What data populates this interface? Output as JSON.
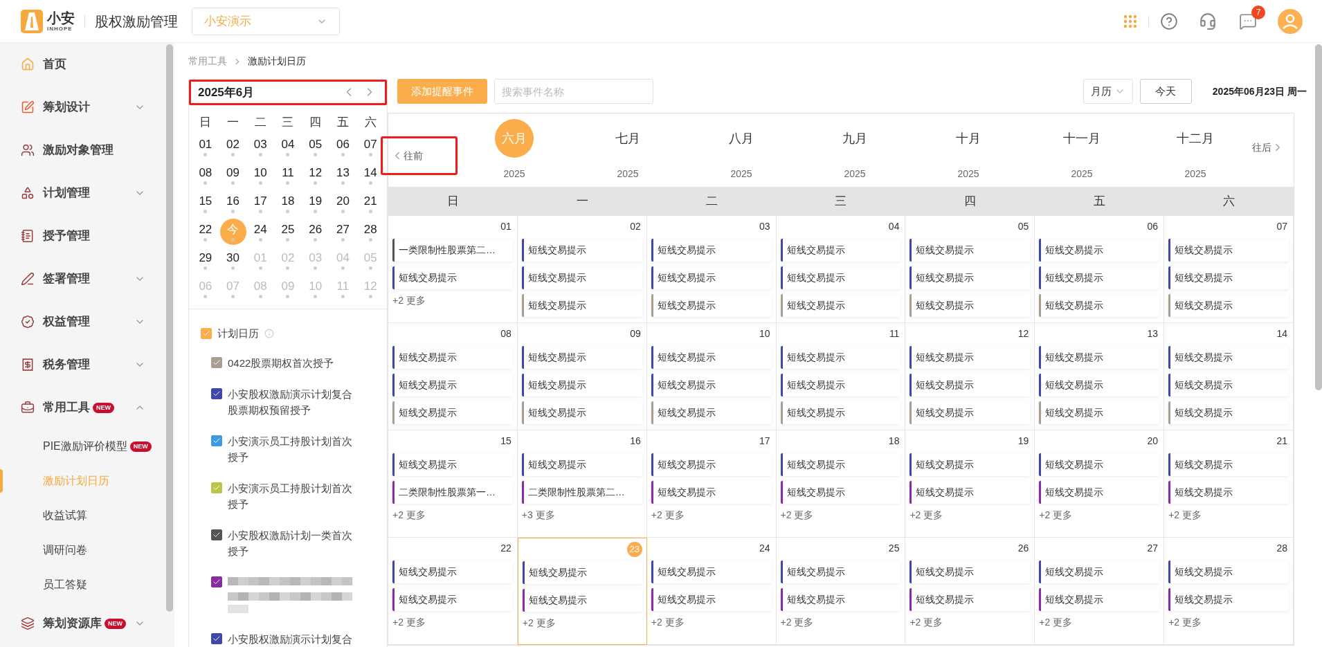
{
  "header": {
    "logo_text": "小安",
    "logo_sub": "INHOPE",
    "app_title": "股权激励管理",
    "company_select": "小安演示",
    "notification_count": "7"
  },
  "sidebar": {
    "items": [
      {
        "kind": "link",
        "label": "首页",
        "selected": false
      },
      {
        "kind": "group",
        "label": "筹划设计",
        "expanded": false
      },
      {
        "kind": "link",
        "label": "激励对象管理",
        "selected": false
      },
      {
        "kind": "group",
        "label": "计划管理",
        "expanded": false
      },
      {
        "kind": "link",
        "label": "授予管理",
        "selected": false
      },
      {
        "kind": "group",
        "label": "签署管理",
        "expanded": false
      },
      {
        "kind": "group",
        "label": "权益管理",
        "expanded": false
      },
      {
        "kind": "group",
        "label": "税务管理",
        "expanded": false
      },
      {
        "kind": "group",
        "label": "常用工具",
        "badge": "NEW",
        "expanded": true,
        "children": [
          {
            "label": "PIE激励评价模型",
            "badge": "NEW",
            "selected": false
          },
          {
            "label": "激励计划日历",
            "selected": true
          },
          {
            "label": "收益试算",
            "selected": false
          },
          {
            "label": "调研问卷",
            "selected": false
          },
          {
            "label": "员工答疑",
            "selected": false
          }
        ]
      },
      {
        "kind": "group",
        "label": "筹划资源库",
        "badge": "NEW",
        "expanded": false
      }
    ]
  },
  "breadcrumb": [
    "常用工具",
    "激励计划日历"
  ],
  "mini_calendar": {
    "title": "2025年6月",
    "weekdays": [
      "日",
      "一",
      "二",
      "三",
      "四",
      "五",
      "六"
    ],
    "weeks": [
      [
        {
          "label": "01",
          "other_month": false,
          "today": false
        },
        {
          "label": "02",
          "other_month": false,
          "today": false
        },
        {
          "label": "03",
          "other_month": false,
          "today": false
        },
        {
          "label": "04",
          "other_month": false,
          "today": false
        },
        {
          "label": "05",
          "other_month": false,
          "today": false
        },
        {
          "label": "06",
          "other_month": false,
          "today": false
        },
        {
          "label": "07",
          "other_month": false,
          "today": false
        }
      ],
      [
        {
          "label": "08",
          "other_month": false,
          "today": false
        },
        {
          "label": "09",
          "other_month": false,
          "today": false
        },
        {
          "label": "10",
          "other_month": false,
          "today": false
        },
        {
          "label": "11",
          "other_month": false,
          "today": false
        },
        {
          "label": "12",
          "other_month": false,
          "today": false
        },
        {
          "label": "13",
          "other_month": false,
          "today": false
        },
        {
          "label": "14",
          "other_month": false,
          "today": false
        }
      ],
      [
        {
          "label": "15",
          "other_month": false,
          "today": false
        },
        {
          "label": "16",
          "other_month": false,
          "today": false
        },
        {
          "label": "17",
          "other_month": false,
          "today": false
        },
        {
          "label": "18",
          "other_month": false,
          "today": false
        },
        {
          "label": "19",
          "other_month": false,
          "today": false
        },
        {
          "label": "20",
          "other_month": false,
          "today": false
        },
        {
          "label": "21",
          "other_month": false,
          "today": false
        }
      ],
      [
        {
          "label": "22",
          "other_month": false,
          "today": false
        },
        {
          "label": "今",
          "other_month": false,
          "today": true
        },
        {
          "label": "24",
          "other_month": false,
          "today": false
        },
        {
          "label": "25",
          "other_month": false,
          "today": false
        },
        {
          "label": "26",
          "other_month": false,
          "today": false
        },
        {
          "label": "27",
          "other_month": false,
          "today": false
        },
        {
          "label": "28",
          "other_month": false,
          "today": false
        }
      ],
      [
        {
          "label": "29",
          "other_month": false,
          "today": false
        },
        {
          "label": "30",
          "other_month": false,
          "today": false
        },
        {
          "label": "01",
          "other_month": true,
          "today": false
        },
        {
          "label": "02",
          "other_month": true,
          "today": false
        },
        {
          "label": "03",
          "other_month": true,
          "today": false
        },
        {
          "label": "04",
          "other_month": true,
          "today": false
        },
        {
          "label": "05",
          "other_month": true,
          "today": false
        }
      ],
      [
        {
          "label": "06",
          "other_month": true,
          "today": false
        },
        {
          "label": "07",
          "other_month": true,
          "today": false
        },
        {
          "label": "08",
          "other_month": true,
          "today": false
        },
        {
          "label": "09",
          "other_month": true,
          "today": false
        },
        {
          "label": "10",
          "other_month": true,
          "today": false
        },
        {
          "label": "11",
          "other_month": true,
          "today": false
        },
        {
          "label": "12",
          "other_month": true,
          "today": false
        }
      ]
    ]
  },
  "plan_calendar": {
    "label": "计划日历",
    "checked": true,
    "plans": [
      {
        "kind": "text",
        "label": "0422股票期权首次授予",
        "color": "#a89e92",
        "checked": true
      },
      {
        "kind": "text",
        "label": "小安股权激励演示计划复合股票期权预留授予",
        "color": "#3d47ad",
        "checked": true
      },
      {
        "kind": "text",
        "label": "小安演示员工持股计划首次授予",
        "color": "#3c9ae4",
        "checked": true
      },
      {
        "kind": "text",
        "label": "小安演示员工持股计划首次授予",
        "color": "#b9c64a",
        "checked": true
      },
      {
        "kind": "text",
        "label": "小安股权激励计划一类首次授予",
        "color": "#555555",
        "checked": true
      },
      {
        "kind": "blurred",
        "color": "#8a2aa6",
        "checked": true
      },
      {
        "kind": "text",
        "label": "小安股权激励演示计划复合",
        "color": "#3d47ad",
        "checked": true
      }
    ]
  },
  "toolbar": {
    "add_button": "添加提醒事件",
    "search_placeholder": "搜索事件名称",
    "view_select": "月历",
    "today_button": "今天",
    "current_date": "2025年06月23日 周一"
  },
  "month_strip": {
    "prev": "往前",
    "next": "往后",
    "months": [
      {
        "label": "六月",
        "year": "2025",
        "selected": true
      },
      {
        "label": "七月",
        "year": "2025",
        "selected": false
      },
      {
        "label": "八月",
        "year": "2025",
        "selected": false
      },
      {
        "label": "九月",
        "year": "2025",
        "selected": false
      },
      {
        "label": "十月",
        "year": "2025",
        "selected": false
      },
      {
        "label": "十一月",
        "year": "2025",
        "selected": false
      },
      {
        "label": "十二月",
        "year": "2025",
        "selected": false
      }
    ]
  },
  "calendar": {
    "weekdays": [
      "日",
      "一",
      "二",
      "三",
      "四",
      "五",
      "六"
    ],
    "weeks": [
      [
        {
          "date": "01",
          "today": false,
          "events": [
            {
              "title": "一类限制性股票第二…",
              "color": "#555555"
            },
            {
              "title": "短线交易提示",
              "color": "#3d47ad"
            }
          ],
          "more": "+2 更多"
        },
        {
          "date": "02",
          "today": false,
          "events": [
            {
              "title": "短线交易提示",
              "color": "#3d47ad"
            },
            {
              "title": "短线交易提示",
              "color": "#3d47ad"
            },
            {
              "title": "短线交易提示",
              "color": "#a89e92"
            }
          ]
        },
        {
          "date": "03",
          "today": false,
          "events": [
            {
              "title": "短线交易提示",
              "color": "#3d47ad"
            },
            {
              "title": "短线交易提示",
              "color": "#3d47ad"
            },
            {
              "title": "短线交易提示",
              "color": "#a89e92"
            }
          ]
        },
        {
          "date": "04",
          "today": false,
          "events": [
            {
              "title": "短线交易提示",
              "color": "#3d47ad"
            },
            {
              "title": "短线交易提示",
              "color": "#3d47ad"
            },
            {
              "title": "短线交易提示",
              "color": "#a89e92"
            }
          ]
        },
        {
          "date": "05",
          "today": false,
          "events": [
            {
              "title": "短线交易提示",
              "color": "#3d47ad"
            },
            {
              "title": "短线交易提示",
              "color": "#3d47ad"
            },
            {
              "title": "短线交易提示",
              "color": "#a89e92"
            }
          ]
        },
        {
          "date": "06",
          "today": false,
          "events": [
            {
              "title": "短线交易提示",
              "color": "#3d47ad"
            },
            {
              "title": "短线交易提示",
              "color": "#3d47ad"
            },
            {
              "title": "短线交易提示",
              "color": "#a89e92"
            }
          ]
        },
        {
          "date": "07",
          "today": false,
          "events": [
            {
              "title": "短线交易提示",
              "color": "#3d47ad"
            },
            {
              "title": "短线交易提示",
              "color": "#3d47ad"
            },
            {
              "title": "短线交易提示",
              "color": "#a89e92"
            }
          ]
        }
      ],
      [
        {
          "date": "08",
          "today": false,
          "events": [
            {
              "title": "短线交易提示",
              "color": "#3d47ad"
            },
            {
              "title": "短线交易提示",
              "color": "#3d47ad"
            },
            {
              "title": "短线交易提示",
              "color": "#a89e92"
            }
          ]
        },
        {
          "date": "09",
          "today": false,
          "events": [
            {
              "title": "短线交易提示",
              "color": "#3d47ad"
            },
            {
              "title": "短线交易提示",
              "color": "#3d47ad"
            },
            {
              "title": "短线交易提示",
              "color": "#a89e92"
            }
          ]
        },
        {
          "date": "10",
          "today": false,
          "events": [
            {
              "title": "短线交易提示",
              "color": "#3d47ad"
            },
            {
              "title": "短线交易提示",
              "color": "#3d47ad"
            },
            {
              "title": "短线交易提示",
              "color": "#a89e92"
            }
          ]
        },
        {
          "date": "11",
          "today": false,
          "events": [
            {
              "title": "短线交易提示",
              "color": "#3d47ad"
            },
            {
              "title": "短线交易提示",
              "color": "#3d47ad"
            },
            {
              "title": "短线交易提示",
              "color": "#a89e92"
            }
          ]
        },
        {
          "date": "12",
          "today": false,
          "events": [
            {
              "title": "短线交易提示",
              "color": "#3d47ad"
            },
            {
              "title": "短线交易提示",
              "color": "#3d47ad"
            },
            {
              "title": "短线交易提示",
              "color": "#a89e92"
            }
          ]
        },
        {
          "date": "13",
          "today": false,
          "events": [
            {
              "title": "短线交易提示",
              "color": "#3d47ad"
            },
            {
              "title": "短线交易提示",
              "color": "#3d47ad"
            },
            {
              "title": "短线交易提示",
              "color": "#a89e92"
            }
          ]
        },
        {
          "date": "14",
          "today": false,
          "events": [
            {
              "title": "短线交易提示",
              "color": "#3d47ad"
            },
            {
              "title": "短线交易提示",
              "color": "#3d47ad"
            },
            {
              "title": "短线交易提示",
              "color": "#a89e92"
            }
          ]
        }
      ],
      [
        {
          "date": "15",
          "today": false,
          "events": [
            {
              "title": "短线交易提示",
              "color": "#3d47ad"
            },
            {
              "title": "二类限制性股票第一…",
              "color": "#8a2aa6"
            }
          ],
          "more": "+2 更多"
        },
        {
          "date": "16",
          "today": false,
          "events": [
            {
              "title": "短线交易提示",
              "color": "#3d47ad"
            },
            {
              "title": "二类限制性股票第二…",
              "color": "#8a2aa6"
            }
          ],
          "more": "+3 更多"
        },
        {
          "date": "17",
          "today": false,
          "events": [
            {
              "title": "短线交易提示",
              "color": "#3d47ad"
            },
            {
              "title": "短线交易提示",
              "color": "#8a2aa6"
            }
          ],
          "more": "+2 更多"
        },
        {
          "date": "18",
          "today": false,
          "events": [
            {
              "title": "短线交易提示",
              "color": "#3d47ad"
            },
            {
              "title": "短线交易提示",
              "color": "#8a2aa6"
            }
          ],
          "more": "+2 更多"
        },
        {
          "date": "19",
          "today": false,
          "events": [
            {
              "title": "短线交易提示",
              "color": "#3d47ad"
            },
            {
              "title": "短线交易提示",
              "color": "#8a2aa6"
            }
          ],
          "more": "+2 更多"
        },
        {
          "date": "20",
          "today": false,
          "events": [
            {
              "title": "短线交易提示",
              "color": "#3d47ad"
            },
            {
              "title": "短线交易提示",
              "color": "#8a2aa6"
            }
          ],
          "more": "+2 更多"
        },
        {
          "date": "21",
          "today": false,
          "events": [
            {
              "title": "短线交易提示",
              "color": "#3d47ad"
            },
            {
              "title": "短线交易提示",
              "color": "#8a2aa6"
            }
          ],
          "more": "+2 更多"
        }
      ],
      [
        {
          "date": "22",
          "today": false,
          "events": [
            {
              "title": "短线交易提示",
              "color": "#3d47ad"
            },
            {
              "title": "短线交易提示",
              "color": "#8a2aa6"
            }
          ],
          "more": "+2 更多"
        },
        {
          "date": "23",
          "today": true,
          "events": [
            {
              "title": "短线交易提示",
              "color": "#3d47ad"
            },
            {
              "title": "短线交易提示",
              "color": "#8a2aa6"
            }
          ],
          "more": "+2 更多"
        },
        {
          "date": "24",
          "today": false,
          "events": [
            {
              "title": "短线交易提示",
              "color": "#3d47ad"
            },
            {
              "title": "短线交易提示",
              "color": "#8a2aa6"
            }
          ],
          "more": "+2 更多"
        },
        {
          "date": "25",
          "today": false,
          "events": [
            {
              "title": "短线交易提示",
              "color": "#3d47ad"
            },
            {
              "title": "短线交易提示",
              "color": "#8a2aa6"
            }
          ],
          "more": "+2 更多"
        },
        {
          "date": "26",
          "today": false,
          "events": [
            {
              "title": "短线交易提示",
              "color": "#3d47ad"
            },
            {
              "title": "短线交易提示",
              "color": "#8a2aa6"
            }
          ],
          "more": "+2 更多"
        },
        {
          "date": "27",
          "today": false,
          "events": [
            {
              "title": "短线交易提示",
              "color": "#3d47ad"
            },
            {
              "title": "短线交易提示",
              "color": "#8a2aa6"
            }
          ],
          "more": "+2 更多"
        },
        {
          "date": "28",
          "today": false,
          "events": [
            {
              "title": "短线交易提示",
              "color": "#3d47ad"
            },
            {
              "title": "短线交易提示",
              "color": "#8a2aa6"
            }
          ],
          "more": "+2 更多"
        }
      ]
    ]
  }
}
